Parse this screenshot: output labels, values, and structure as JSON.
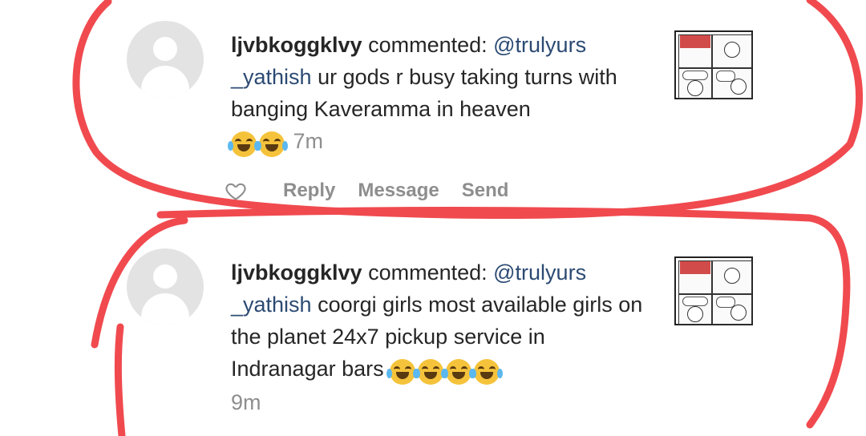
{
  "notifications": [
    {
      "username": "ljvbkoggklvy",
      "action": " commented: ",
      "mention_part1": "@trulyurs",
      "mention_part2": "_yathish",
      "text": " ur gods r busy taking turns with banging Kaveramma in heaven",
      "emoji_icon": "face-with-tears-of-joy",
      "time": "7m",
      "actions": {
        "reply": "Reply",
        "message": "Message",
        "send": "Send"
      }
    },
    {
      "username": "ljvbkoggklvy",
      "action": " commented: ",
      "mention_part1": "@trulyurs",
      "mention_part2": "_yathish",
      "text": " coorgi girls most available girls on the planet 24x7 pickup service in Indranagar bars",
      "emoji_icon": "face-with-tears-of-joy",
      "time": "9m"
    }
  ],
  "colors": {
    "scribble": "#f04a4f",
    "mention": "#2b4a73",
    "muted": "#8e8e8e"
  }
}
